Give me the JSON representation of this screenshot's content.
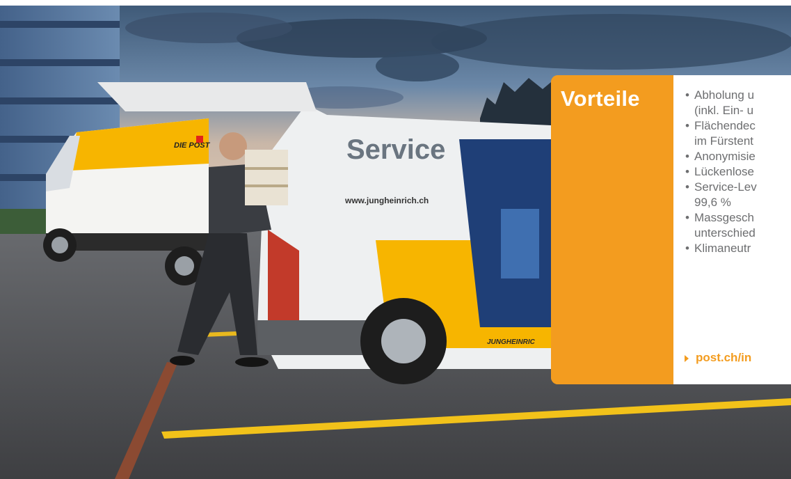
{
  "scene": {
    "van_left_logo": "DIE POST",
    "van_right_text": "Service",
    "van_right_url": "www.jungheinrich.ch",
    "van_right_brand": "JUNGHEINRIC"
  },
  "panel": {
    "title": "Vorteile",
    "items": [
      {
        "line1": "Abholung u",
        "line2": "(inkl. Ein- u"
      },
      {
        "line1": "Flächendec",
        "line2": "im Fürstent"
      },
      {
        "line1": "Anonymisie",
        "line2": ""
      },
      {
        "line1": "Lückenlose",
        "line2": ""
      },
      {
        "line1": "Service-Lev",
        "line2": "99,6 %"
      },
      {
        "line1": "Massgesch",
        "line2": "unterschied"
      },
      {
        "line1": "Klimaneutr",
        "line2": ""
      }
    ],
    "link_text": "post.ch/in"
  },
  "colors": {
    "accent_orange": "#f39c1f",
    "body_text": "#6d6e70",
    "post_yellow": "#f7b500"
  }
}
